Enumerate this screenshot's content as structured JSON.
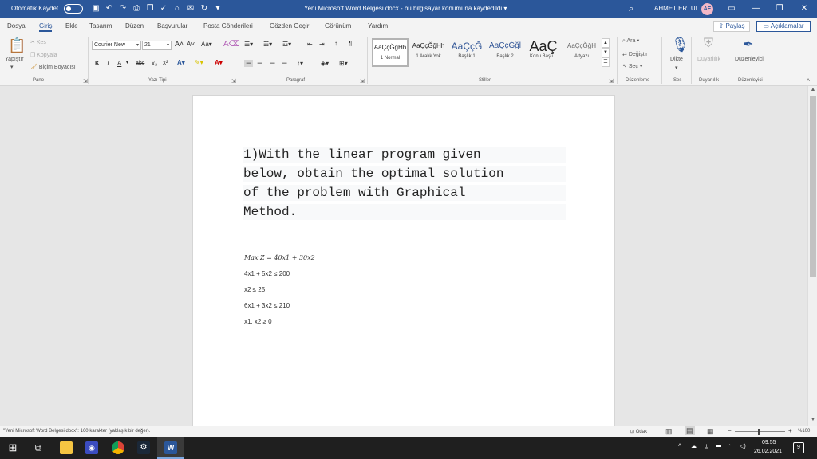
{
  "titlebar": {
    "autosave_label": "Otomatik Kaydet",
    "doc_title": "Yeni Microsoft Word Belgesi.docx  -  bu bilgisayar konumuna kaydedildi  ▾",
    "user_name": "AHMET ERTUL",
    "user_initials": "AE"
  },
  "tabs": [
    "Dosya",
    "Giriş",
    "Ekle",
    "Tasarım",
    "Düzen",
    "Başvurular",
    "Posta Gönderileri",
    "Gözden Geçir",
    "Görünüm",
    "Yardım"
  ],
  "share_label": "Paylaş",
  "comments_label": "Açıklamalar",
  "ribbon": {
    "clipboard": {
      "paste": "Yapıştır",
      "cut": "Kes",
      "copy": "Kopyala",
      "format_painter": "Biçim Boyacısı",
      "label": "Pano"
    },
    "font": {
      "name": "Courier New",
      "size": "21",
      "label": "Yazı Tipi"
    },
    "paragraph": {
      "label": "Paragraf"
    },
    "styles": {
      "items": [
        {
          "sample": "AaÇçĞğHh",
          "name": "1 Normal"
        },
        {
          "sample": "AaÇçĞğHh",
          "name": "1 Aralık Yok"
        },
        {
          "sample": "AaÇçĞ",
          "name": "Başlık 1"
        },
        {
          "sample": "AaÇçĞğl",
          "name": "Başlık 2"
        },
        {
          "sample": "AaÇ",
          "name": "Konu Başlı..."
        },
        {
          "sample": "AaÇçĞğH",
          "name": "Altyazı"
        }
      ],
      "label": "Stiller"
    },
    "editing": {
      "find": "Ara",
      "replace": "Değiştir",
      "select": "Seç",
      "label": "Düzenleme"
    },
    "voice": {
      "dictate": "Dikte",
      "label": "Ses"
    },
    "sensitivity": {
      "button": "Duyarlılık",
      "label": "Duyarlılık"
    },
    "editor": {
      "button": "Düzenleyici",
      "label": "Düzenleyici"
    }
  },
  "document": {
    "heading_lines": [
      "1)With the linear program given",
      "below, obtain the optimal solution",
      "of the problem with Graphical",
      "Method."
    ],
    "objective": "Max Z = 40x1 + 30x2",
    "constraints": [
      "4x1 + 5x2 ≤ 200",
      "x2 ≤ 25",
      "6x1 + 3x2 ≤ 210",
      "x1, x2 ≥ 0"
    ]
  },
  "statusbar": {
    "info": "\"Yeni Microsoft Word Belgesi.docx\": 160 karakter (yaklaşık bir değer).",
    "focus": "Odak",
    "zoom": "%100"
  },
  "taskbar": {
    "time": "09:55",
    "date": "26.02.2021",
    "notifications": "9"
  },
  "colors": {
    "brand": "#2b579a",
    "taskbar": "#1f1f1f"
  }
}
